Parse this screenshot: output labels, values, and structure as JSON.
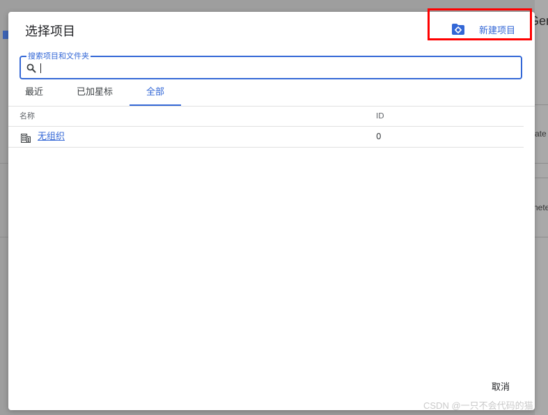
{
  "background": {
    "header_text": "Gen",
    "row1_text": "ate",
    "row2_text": "nete"
  },
  "dialog": {
    "title": "选择项目",
    "new_project_label": "新建项目",
    "search": {
      "label": "搜索项目和文件夹",
      "value": "",
      "placeholder": ""
    },
    "tabs": [
      {
        "label": "最近",
        "active": false
      },
      {
        "label": "已加星标",
        "active": false
      },
      {
        "label": "全部",
        "active": true
      }
    ],
    "table": {
      "columns": [
        "名称",
        "ID"
      ],
      "rows": [
        {
          "icon": "organization-icon",
          "name": "无组织",
          "id": "0"
        }
      ]
    },
    "cancel_label": "取消"
  },
  "watermark": "CSDN @一只不会代码的猫",
  "colors": {
    "accent": "#3367d6",
    "highlight": "#ff0000"
  }
}
